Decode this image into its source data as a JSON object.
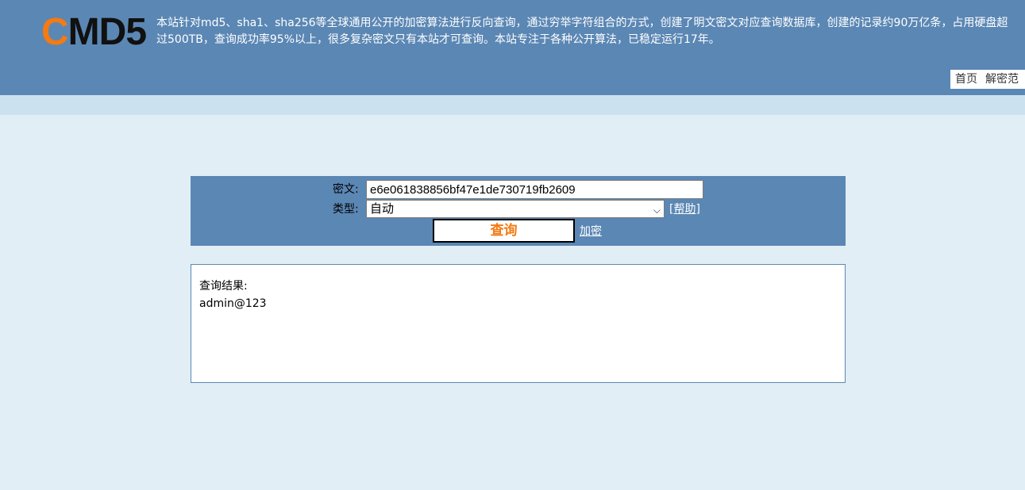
{
  "header": {
    "logo_first": "C",
    "logo_rest": "MD5",
    "intro": "本站针对md5、sha1、sha256等全球通用公开的加密算法进行反向查询，通过穷举字符组合的方式，创建了明文密文对应查询数据库，创建的记录约90万亿条，占用硬盘超过500TB，查询成功率95%以上，很多复杂密文只有本站才可查询。本站专注于各种公开算法，已稳定运行17年。",
    "nav": [
      "首页",
      "解密范"
    ]
  },
  "query": {
    "cipher_label": "密文:",
    "cipher_value": "e6e061838856bf47e1de730719fb2609",
    "type_label": "类型:",
    "type_selected": "自动",
    "help_label": "[帮助]",
    "query_button": "查询",
    "encrypt_link": "加密"
  },
  "result": {
    "label": "查询结果:",
    "value": "admin@123"
  },
  "colors": {
    "header_bg": "#5b87b4",
    "accent_orange": "#f47a12",
    "page_bg": "#e1eef6"
  }
}
